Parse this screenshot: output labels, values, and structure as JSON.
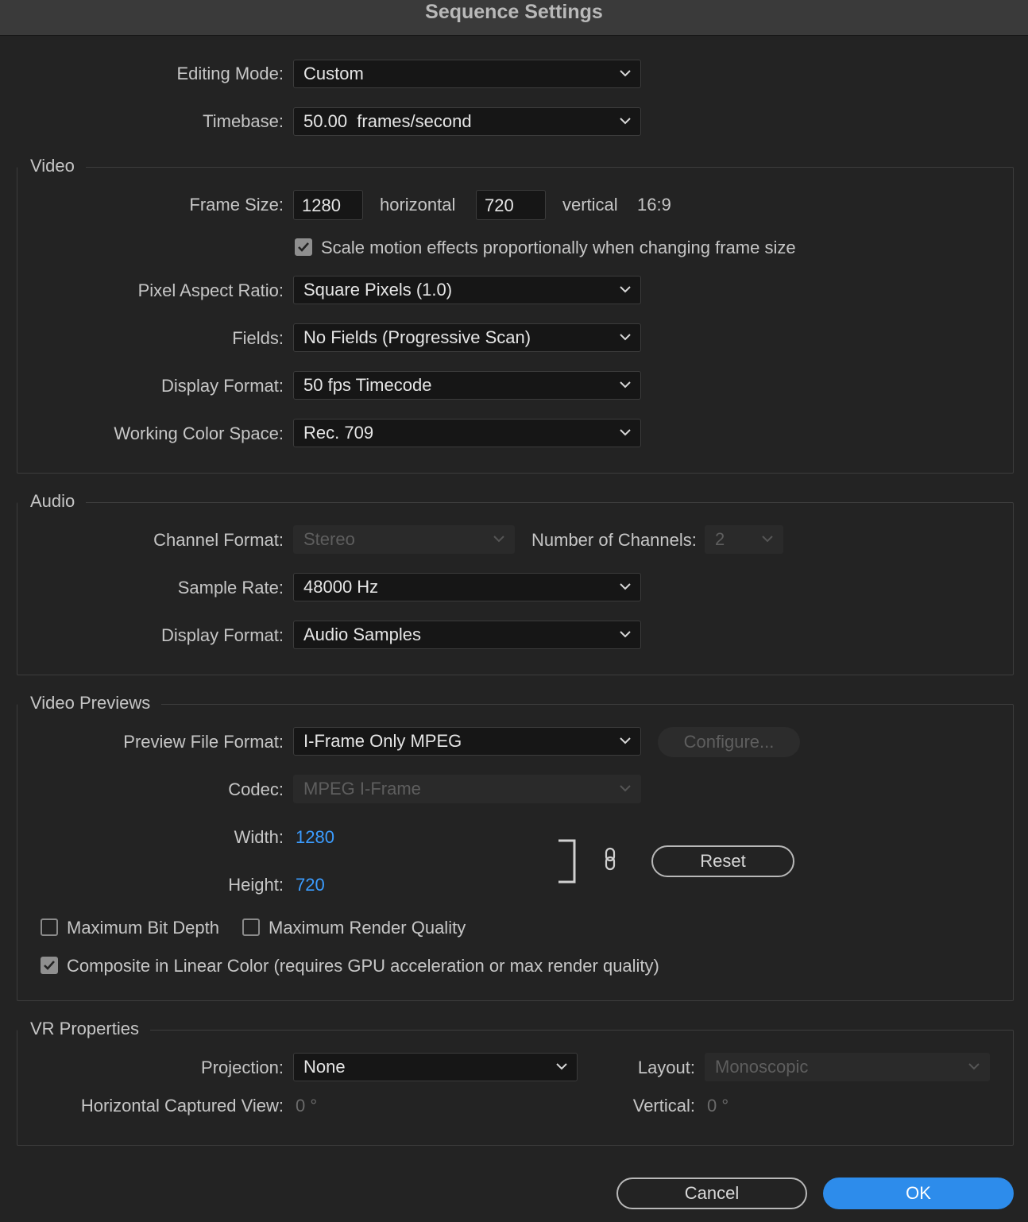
{
  "window": {
    "title": "Sequence Settings"
  },
  "general": {
    "editing_mode_label": "Editing Mode:",
    "editing_mode_value": "Custom",
    "timebase_label": "Timebase:",
    "timebase_value": "50.00  frames/second"
  },
  "video": {
    "section_title": "Video",
    "frame_size_label": "Frame Size:",
    "frame_width": "1280",
    "horizontal_label": "horizontal",
    "frame_height": "720",
    "vertical_label": "vertical",
    "aspect_ratio": "16:9",
    "scale_motion_label": "Scale motion effects proportionally when changing frame size",
    "scale_motion_checked": true,
    "pixel_aspect_label": "Pixel Aspect Ratio:",
    "pixel_aspect_value": "Square Pixels (1.0)",
    "fields_label": "Fields:",
    "fields_value": "No Fields (Progressive Scan)",
    "display_format_label": "Display Format:",
    "display_format_value": "50 fps Timecode",
    "color_space_label": "Working Color Space:",
    "color_space_value": "Rec. 709"
  },
  "audio": {
    "section_title": "Audio",
    "channel_format_label": "Channel Format:",
    "channel_format_value": "Stereo",
    "num_channels_label": "Number of Channels:",
    "num_channels_value": "2",
    "sample_rate_label": "Sample Rate:",
    "sample_rate_value": "48000 Hz",
    "display_format_label": "Display Format:",
    "display_format_value": "Audio Samples"
  },
  "previews": {
    "section_title": "Video Previews",
    "file_format_label": "Preview File Format:",
    "file_format_value": "I-Frame Only MPEG",
    "configure_label": "Configure...",
    "codec_label": "Codec:",
    "codec_value": "MPEG I-Frame",
    "width_label": "Width:",
    "width_value": "1280",
    "height_label": "Height:",
    "height_value": "720",
    "reset_label": "Reset",
    "max_bit_depth_label": "Maximum Bit Depth",
    "max_bit_depth_checked": false,
    "max_render_quality_label": "Maximum Render Quality",
    "max_render_quality_checked": false,
    "linear_color_label": "Composite in Linear Color (requires GPU acceleration or max render quality)",
    "linear_color_checked": true
  },
  "vr": {
    "section_title": "VR Properties",
    "projection_label": "Projection:",
    "projection_value": "None",
    "layout_label": "Layout:",
    "layout_value": "Monoscopic",
    "h_view_label": "Horizontal Captured View:",
    "h_view_value": "0 °",
    "vertical_label": "Vertical:",
    "vertical_value": "0 °"
  },
  "footer": {
    "cancel_label": "Cancel",
    "ok_label": "OK"
  },
  "colors": {
    "background": "#232323",
    "accent": "#2d8ceb",
    "link_value": "#3b9cff"
  }
}
